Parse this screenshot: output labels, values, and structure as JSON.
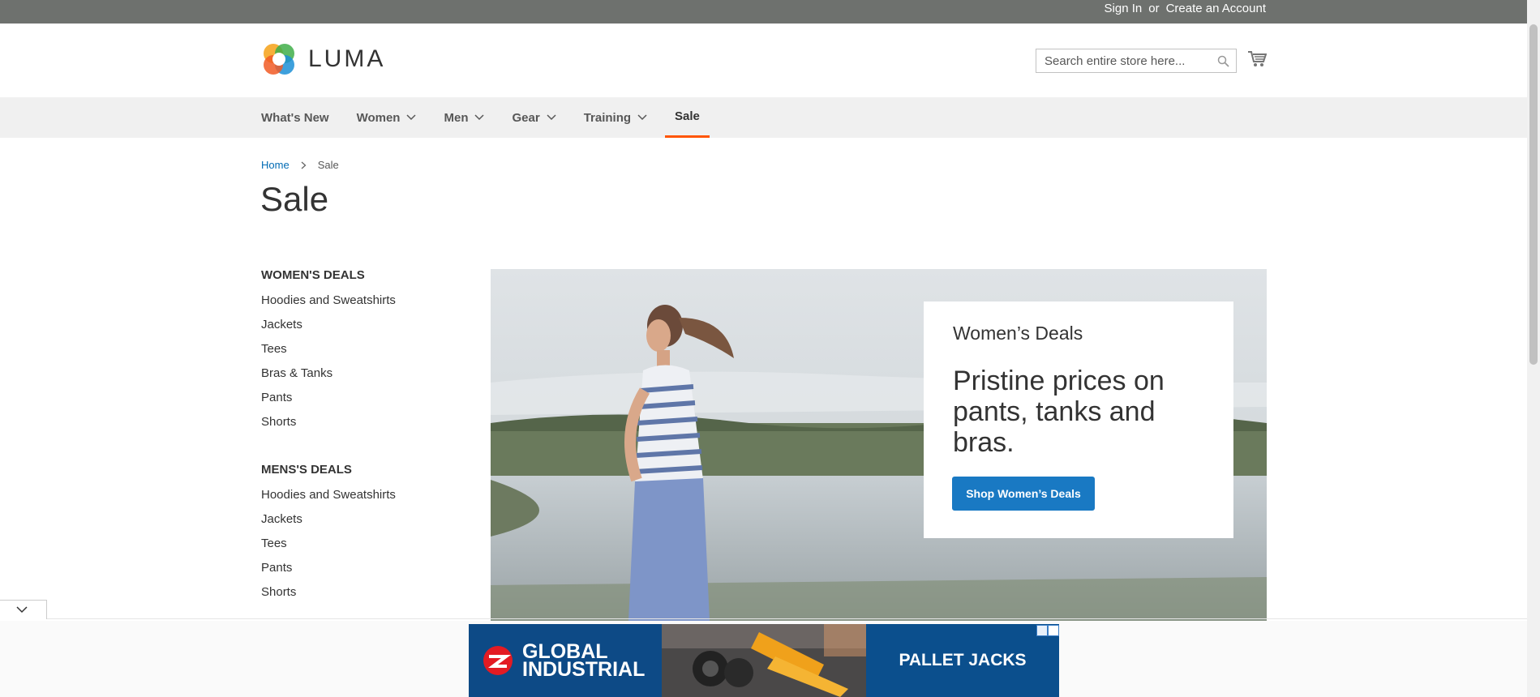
{
  "topbar": {
    "sign_in": "Sign In",
    "or": "or",
    "create_account": "Create an Account"
  },
  "header": {
    "logo_text": "LUMA",
    "search_placeholder": "Search entire store here...",
    "icons": {
      "search": "search-icon",
      "cart": "cart-icon"
    }
  },
  "nav": {
    "items": [
      {
        "label": "What's New",
        "dropdown": false
      },
      {
        "label": "Women",
        "dropdown": true
      },
      {
        "label": "Men",
        "dropdown": true
      },
      {
        "label": "Gear",
        "dropdown": true
      },
      {
        "label": "Training",
        "dropdown": true
      },
      {
        "label": "Sale",
        "dropdown": false,
        "active": true
      }
    ],
    "accent_color": "#ff5501"
  },
  "breadcrumb": {
    "home": "Home",
    "current": "Sale"
  },
  "page": {
    "title": "Sale"
  },
  "sidebar": {
    "womens_title": "WOMEN'S DEALS",
    "womens_items": [
      "Hoodies and Sweatshirts",
      "Jackets",
      "Tees",
      "Bras & Tanks",
      "Pants",
      "Shorts"
    ],
    "mens_title": "MENS'S DEALS",
    "mens_items": [
      "Hoodies and Sweatshirts",
      "Jackets",
      "Tees",
      "Pants",
      "Shorts"
    ]
  },
  "banner": {
    "kicker": "Women’s Deals",
    "headline": "Pristine prices on pants, tanks and bras.",
    "button": "Shop Women’s Deals",
    "button_color": "#1979c3"
  },
  "ad": {
    "brand_line1": "GLOBAL",
    "brand_line2": "INDUSTRIAL",
    "tagline": "PALLET JACKS"
  }
}
